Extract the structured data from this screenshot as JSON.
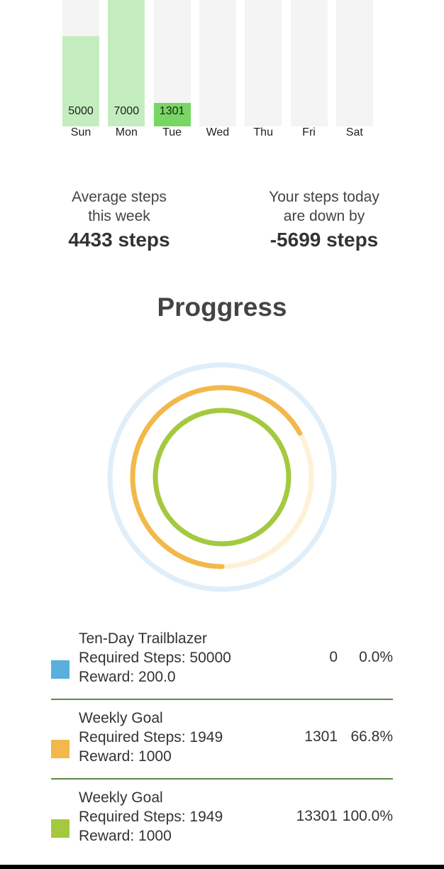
{
  "chart_data": {
    "type": "bar",
    "categories": [
      "Sun",
      "Mon",
      "Tue",
      "Wed",
      "Thu",
      "Fri",
      "Sat"
    ],
    "values": [
      5000,
      7000,
      1301,
      0,
      0,
      0,
      0
    ],
    "value_labels": [
      "5000",
      "7000",
      "1301",
      "",
      "",
      "",
      ""
    ],
    "ylim": [
      0,
      7000
    ],
    "bar_colors": [
      "#c4edbf",
      "#c4edbf",
      "#78d662",
      "#c4edbf",
      "#c4edbf",
      "#c4edbf",
      "#c4edbf"
    ],
    "track_color": "#f4f4f4"
  },
  "stats": {
    "average": {
      "line1": "Average steps",
      "line2": "this week",
      "value": "4433 steps"
    },
    "today": {
      "line1": "Your steps today",
      "line2": "are down by",
      "value": "-5699 steps"
    }
  },
  "progress": {
    "title": "Proggress",
    "rings": [
      {
        "name": "Ten-Day Trailblazer",
        "fraction": 0.0,
        "color": "#5aafdc",
        "track": "#dfeef9"
      },
      {
        "name": "Weekly Goal",
        "fraction": 0.668,
        "color": "#f2b84b",
        "track": "#fdf1d6"
      },
      {
        "name": "Weekly Goal",
        "fraction": 1.0,
        "color": "#a4c93f",
        "track": "#e9f3d2"
      }
    ]
  },
  "goals": [
    {
      "title": "Ten-Day Trailblazer",
      "required": "Required Steps: 50000",
      "reward": "Reward: 200.0",
      "current": "0",
      "percent": "0.0%",
      "color": "#5aafdc"
    },
    {
      "title": "Weekly Goal",
      "required": "Required Steps: 1949",
      "reward": "Reward: 1000",
      "current": "1301",
      "percent": "66.8%",
      "color": "#f2b84b"
    },
    {
      "title": "Weekly Goal",
      "required": "Required Steps: 1949",
      "reward": "Reward: 1000",
      "current": "13301",
      "percent": "100.0%",
      "color": "#a4c93f"
    }
  ]
}
